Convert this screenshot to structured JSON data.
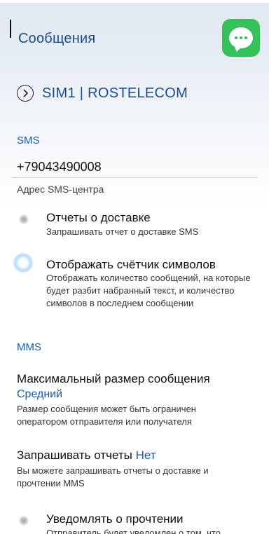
{
  "header": {
    "title": "Сообщения",
    "app_icon": "messages-app-icon"
  },
  "sim": {
    "label": "SIM1 | ROSTELECOM"
  },
  "sms_section": {
    "label": "SMS",
    "sms_center_value": "+79043490008",
    "sms_center_label": "Адрес SMS-центра",
    "delivery_reports": {
      "title": "Отчеты о доставке",
      "description": "Запрашивать отчет о доставке SMS",
      "enabled": false
    },
    "char_counter": {
      "title": "Отображать счётчик символов",
      "description": "Отображать количество сообщений, на которые будет разбит набранный текст, и количество символов в последнем сообщении",
      "enabled": true
    }
  },
  "mms_section": {
    "label": "MMS",
    "max_size": {
      "title": "Максимальный размер сообщения",
      "value": "Средний",
      "description": "Размер сообщения может быть ограничен оператором отправителя или получателя"
    },
    "request_reports": {
      "title": "Запрашивать отчеты",
      "value": "Нет",
      "description": "Вы можете запрашивать отчеты о доставке и прочтении MMS"
    },
    "read_notify": {
      "title": "Уведомлять о прочтении",
      "description": "Отправитель будет уведомлен о том, что",
      "enabled": false
    }
  },
  "colors": {
    "accent": "#1a5ca8",
    "title_blue": "#1a4c8a",
    "app_icon_green": "#35c05a"
  }
}
